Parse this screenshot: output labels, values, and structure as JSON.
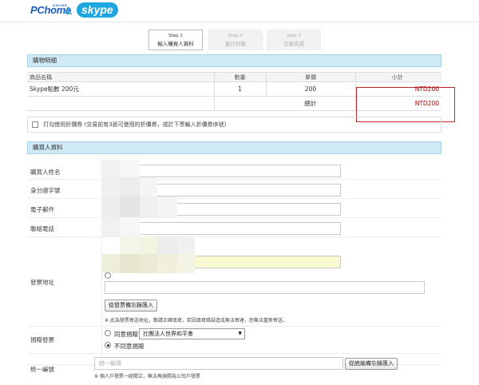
{
  "brand": {
    "pchome": "PChome",
    "pchome_sup": "ONLINE",
    "amp": "&",
    "skype": "skype"
  },
  "steps": [
    {
      "num": "Step 1",
      "label": "輸入購買人資料",
      "active": true
    },
    {
      "num": "Step 2",
      "label": "進行付款",
      "active": false
    },
    {
      "num": "Step 3",
      "label": "交易完成",
      "active": false
    }
  ],
  "cart": {
    "section_title": "購物明細",
    "headers": [
      "商品名稱",
      "數量",
      "單價",
      "小計"
    ],
    "rows": [
      {
        "name": "Skype點數 200元",
        "qty": "1",
        "price": "200",
        "subtotal": "NTD200"
      }
    ],
    "total_label": "總計",
    "total_value": "NTD200"
  },
  "coupon": {
    "label": "打勾使用折價券 (交易前有3張可使用的折價券，或於下票輸入折價券序號)"
  },
  "buyer": {
    "section_title": "購買人資料",
    "name_label": "購買人姓名",
    "id_label": "身分證字號",
    "email_label": "電子郵件",
    "phone_label": "聯絡電話",
    "invoice_label": "發票地址",
    "invoice_button": "從發票備忘錄匯入",
    "invoice_note": "※ 此為發票寄送地址，敬請正確填寫，若因填寫錯誤造成無法寄達，恕無法重新寄送。",
    "donate_label": "捐贈發票",
    "donate_agree": "同意捐贈",
    "donate_org": "社團法人世界和平會",
    "donate_disagree": "不同意捐贈",
    "tax_label": "統一編號",
    "tax_placeholder": "統一編號",
    "tax_button": "從統編備忘錄匯入",
    "tax_note": "※ 個人戶發票一經開立，無法再換開為公司戶發票"
  },
  "colors": {
    "section_bg": "#cfe9f7",
    "price_red": "#aa0000",
    "highlight_box": "#c0272d",
    "skype_blue": "#1ea6e0"
  }
}
